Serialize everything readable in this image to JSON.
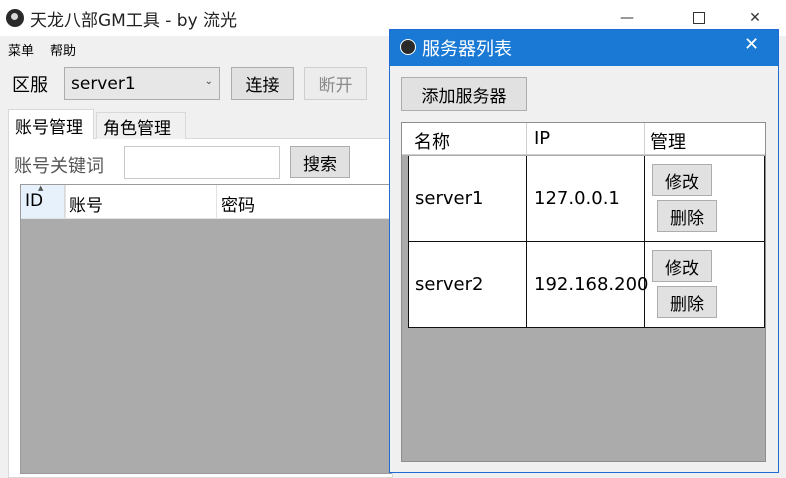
{
  "main_window": {
    "title": "天龙八部GM工具 - by 流光",
    "controls": {
      "minimize": "—",
      "maximize": "",
      "close": "✕"
    },
    "menu": [
      "菜单",
      "帮助"
    ],
    "server_label": "区服",
    "server_select": {
      "value": "server1",
      "arrow": "⌄"
    },
    "connect_label": "连接",
    "disconnect_label": "断开",
    "tabs": [
      "账号管理",
      "角色管理"
    ],
    "keyword_label": "账号关键词",
    "keyword_value": "",
    "search_label": "搜索",
    "grid_columns": [
      "ID",
      "账号",
      "密码"
    ],
    "sort_indicator": "▲"
  },
  "dialog": {
    "title": "服务器列表",
    "close": "✕",
    "add_label": "添加服务器",
    "columns": [
      "名称",
      "IP",
      "管理"
    ],
    "rows": [
      {
        "name": "server1",
        "ip": "127.0.0.1",
        "edit": "修改",
        "delete": "删除"
      },
      {
        "name": "server2",
        "ip": "192.168.200",
        "edit": "修改",
        "delete": "删除"
      }
    ]
  },
  "colors": {
    "dialog_titlebar": "#1979d4",
    "grid_empty": "#ababab",
    "button_face": "#e1e1e1"
  }
}
